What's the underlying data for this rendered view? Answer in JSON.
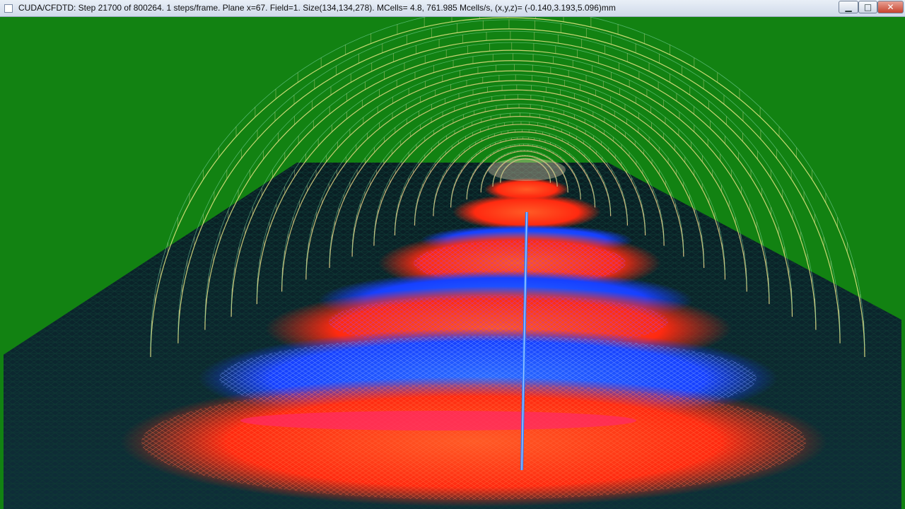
{
  "window": {
    "title": "CUDA/CFDTD: Step 21700 of 800264. 1 steps/frame. Plane x=67. Field=1. Size(134,134,278). MCells= 4.8, 761.985 Mcells/s, (x,y,z)= (-0.140,3.193,5.096)mm",
    "buttons": {
      "minimize_glyph": "▁",
      "maximize_glyph": "□",
      "close_glyph": "✕"
    }
  },
  "colors": {
    "background": "#128212",
    "field_positive": "#ff3a1a",
    "field_negative": "#1f5bff",
    "mesh_wire": "#0a3a28",
    "dome_wire": "#d9e67a"
  }
}
